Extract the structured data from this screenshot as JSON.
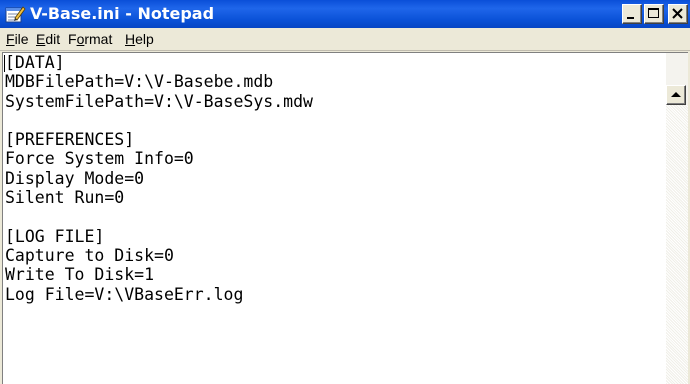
{
  "window": {
    "title": "V-Base.ini - Notepad",
    "icon": "notepad-icon"
  },
  "title_buttons": {
    "minimize_icon": "minimize-icon",
    "maximize_icon": "maximize-icon",
    "close_icon": "close-icon"
  },
  "menu": {
    "items": [
      {
        "label": "File",
        "accel": "F",
        "rest": "ile"
      },
      {
        "label": "Edit",
        "accel": "E",
        "rest": "dit"
      },
      {
        "label": "Format",
        "accel": "o",
        "pre": "F",
        "rest": "rmat"
      },
      {
        "label": "Help",
        "accel": "H",
        "rest": "elp"
      }
    ]
  },
  "editor": {
    "content": "[DATA]\nMDBFilePath=V:\\V-Basebe.mdb\nSystemFilePath=V:\\V-BaseSys.mdw\n\n[PREFERENCES]\nForce System Info=0\nDisplay Mode=0\nSilent Run=0\n\n[LOG FILE]\nCapture to Disk=0\nWrite To Disk=1\nLog File=V:\\VBaseErr.log"
  },
  "scrollbar": {
    "up_icon": "scroll-up-arrow-icon"
  },
  "colors": {
    "titlebar": "#0a4fd8",
    "chrome": "#ece9d8",
    "editor_bg": "#ffffff"
  }
}
